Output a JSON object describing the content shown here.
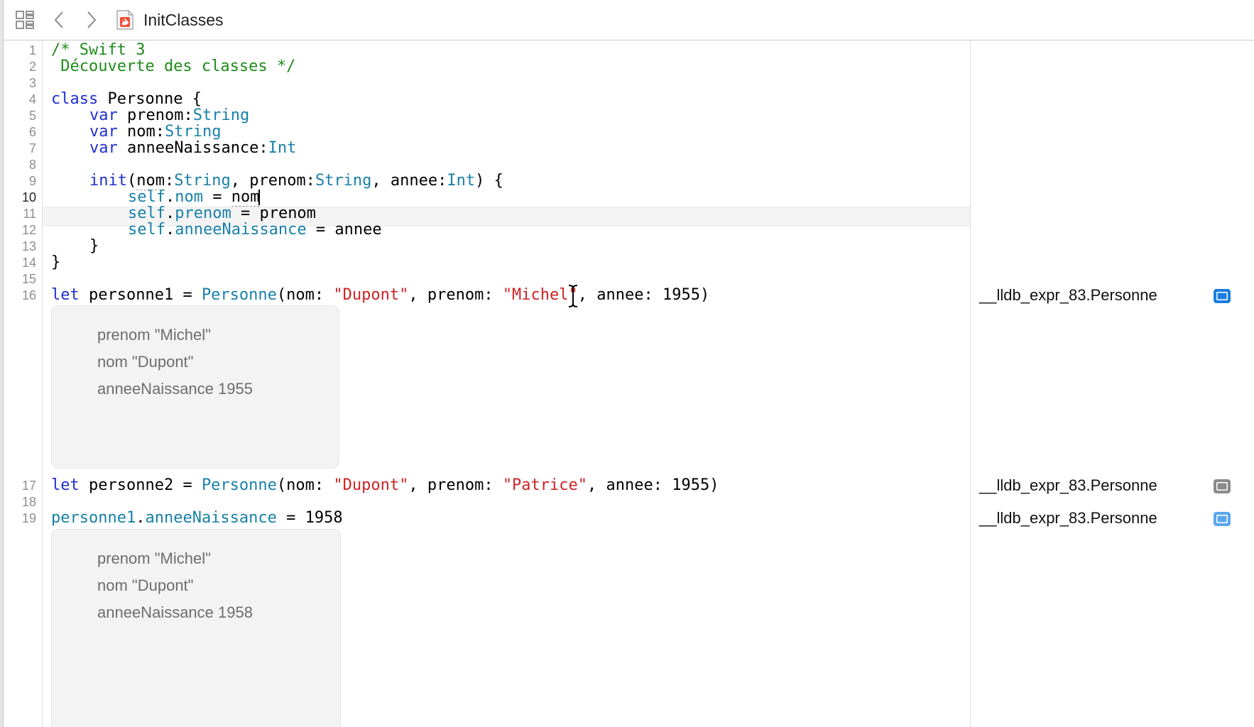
{
  "jumpbar": {
    "file_title": "InitClasses"
  },
  "icons": {
    "grid": "related-items-grid-icon",
    "back": "chevron-left-icon",
    "forward": "chevron-right-icon",
    "file": "swift-file-icon"
  },
  "colors": {
    "comment": "#1f8b1a",
    "keyword": "#1f2fd2",
    "type": "#1880a8",
    "string": "#cf2323",
    "result_button_active": "#1a7fe0",
    "result_button_inactive": "#8a8a8a"
  },
  "editor": {
    "current_line": 10,
    "line_numbers": [
      "1",
      "2",
      "3",
      "4",
      "5",
      "6",
      "7",
      "8",
      "9",
      "10",
      "11",
      "12",
      "13",
      "14",
      "15",
      "16",
      "17",
      "18",
      "19"
    ],
    "code": {
      "l1": "/* Swift 3",
      "l2": " Découverte des classes */",
      "l4_kw": "class",
      "l4_rest": " Personne {",
      "l5_kw": "var",
      "l5_name": " prenom:",
      "l5_type": "String",
      "l6_kw": "var",
      "l6_name": " nom:",
      "l6_type": "String",
      "l7_kw": "var",
      "l7_name": " anneeNaissance:",
      "l7_type": "Int",
      "l9_kw": "init",
      "l9_p1": "(",
      "l9_a1": "nom",
      "l9_p2": ":",
      "l9_t1": "String",
      "l9_p3": ", prenom:",
      "l9_t2": "String",
      "l9_p4": ", annee:",
      "l9_t3": "Int",
      "l9_p5": ") {",
      "l10_self": "self",
      "l10_dot": ".",
      "l10_prop": "nom",
      "l10_eq": " = ",
      "l10_val": "nom",
      "l11_self": "self",
      "l11_dot": ".",
      "l11_prop": "prenom",
      "l11_rest": " = prenom",
      "l12_self": "self",
      "l12_dot": ".",
      "l12_prop": "anneeNaissance",
      "l12_rest": " = annee",
      "l13": "}",
      "l14": "}",
      "l16_kw": "let",
      "l16_a": " personne1 = ",
      "l16_ty": "Personne",
      "l16_b": "(nom: ",
      "l16_s1": "\"Dupont\"",
      "l16_c": ", prenom: ",
      "l16_s2": "\"Michel\"",
      "l16_d": ", annee: 1955)",
      "l17_kw": "let",
      "l17_a": " personne2 = ",
      "l17_ty": "Personne",
      "l17_b": "(nom: ",
      "l17_s1": "\"Dupont\"",
      "l17_c": ", prenom: ",
      "l17_s2": "\"Patrice\"",
      "l17_d": ", annee: 1955)",
      "l19_var": "personne1",
      "l19_dot": ".",
      "l19_prop": "anneeNaissance",
      "l19_rest": " = 1958"
    }
  },
  "inline_results": [
    {
      "lines": [
        "prenom \"Michel\"",
        "nom \"Dupont\"",
        "anneeNaissance 1955"
      ]
    },
    {
      "lines": [
        "prenom \"Michel\"",
        "nom \"Dupont\"",
        "anneeNaissance 1958"
      ]
    }
  ],
  "results_sidebar": [
    {
      "text": "__lldb_expr_83.Personne",
      "active": true
    },
    {
      "text": "__lldb_expr_83.Personne",
      "active": false
    },
    {
      "text": "__lldb_expr_83.Personne",
      "active": true
    }
  ]
}
